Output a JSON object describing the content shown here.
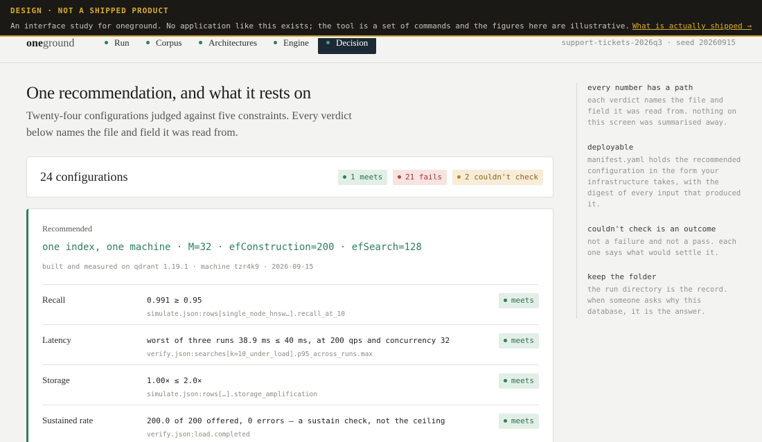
{
  "banner": {
    "tag": "DESIGN · NOT A SHIPPED PRODUCT",
    "text": "An interface study for oneground. No application like this exists; the tool is a set of commands and the figures here are illustrative.",
    "link": "What is actually shipped →"
  },
  "nav": {
    "brand_bold": "one",
    "brand_rest": "ground",
    "items": [
      "Run",
      "Corpus",
      "Architectures",
      "Engine",
      "Decision"
    ],
    "active": "Decision",
    "run_meta": "support-tickets-2026q3 · seed 20260915"
  },
  "page": {
    "title": "One recommendation, and what it rests on",
    "lede": "Twenty-four configurations judged against five constraints. Every verdict below names the file and field it was read from."
  },
  "summary": {
    "title": "24 configurations",
    "meets": "1 meets",
    "fails": "21 fails",
    "couldnt_check": "2 couldn't check"
  },
  "recommended": {
    "label": "Recommended",
    "config": "one index, one machine · M=32 · efConstruction=200 · efSearch=128",
    "built": "built and measured on qdrant 1.19.1 · machine tzr4k9 · 2026-09-15",
    "rows": [
      {
        "name": "Recall",
        "value": "0.991 ≥ 0.95",
        "source": "simulate.json:rows[single_node_hnsw…].recall_at_10",
        "verdict": "meets"
      },
      {
        "name": "Latency",
        "value": "worst of three runs 38.9 ms ≤ 40 ms, at 200 qps and concurrency 32",
        "source": "verify.json:searches[k=10_under_load].p95_across_runs.max",
        "verdict": "meets"
      },
      {
        "name": "Storage",
        "value": "1.00× ≤ 2.0×",
        "source": "simulate.json:rows[…].storage_amplification",
        "verdict": "meets"
      },
      {
        "name": "Sustained rate",
        "value": "200.0 of 200 offered, 0 errors — a sustain check, not the ceiling",
        "source": "verify.json:load.completed",
        "verdict": "meets"
      }
    ]
  },
  "aside": [
    {
      "h": "every number has a path",
      "p": "each verdict names the file and field it was read from. nothing on this screen was summarised away."
    },
    {
      "h": "deployable",
      "p": "manifest.yaml holds the recommended configuration in the form your infrastructure takes, with the digest of every input that produced it."
    },
    {
      "h": "couldn't check is an outcome",
      "p": "not a failure and not a pass. each one says what would settle it."
    },
    {
      "h": "keep the folder",
      "p": "the run directory is the record. when someone asks why this database, it is the answer."
    }
  ]
}
